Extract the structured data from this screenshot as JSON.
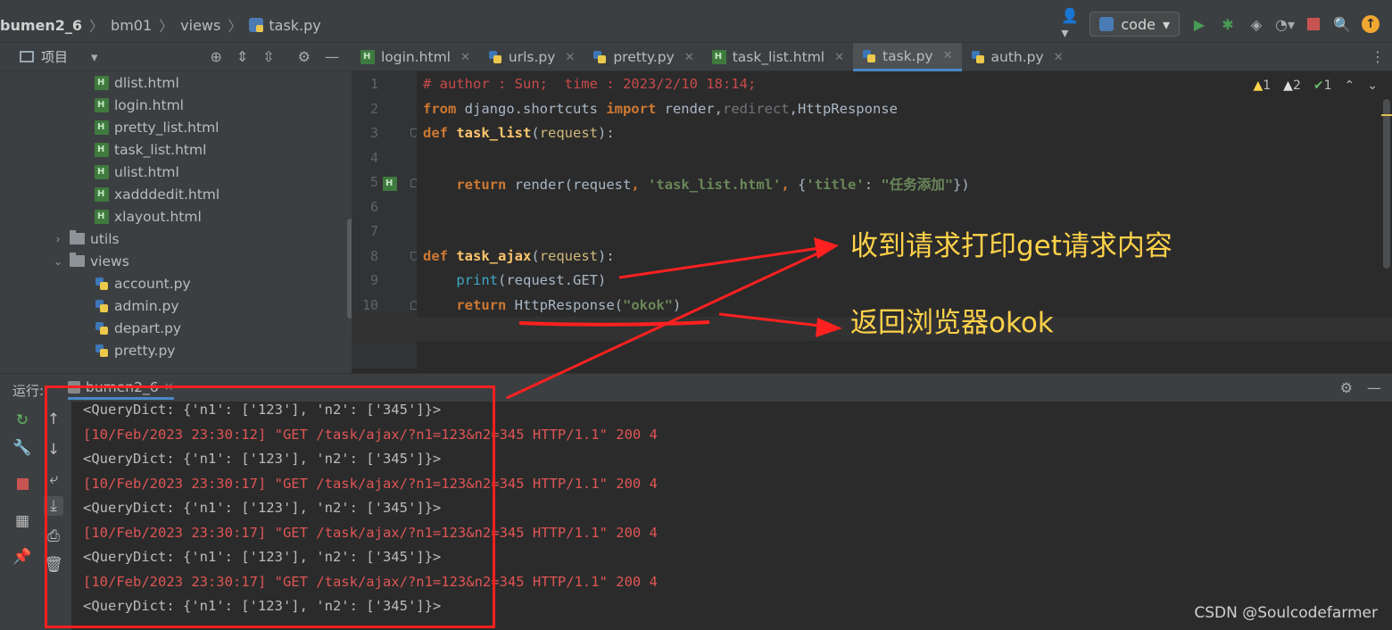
{
  "breadcrumb": {
    "project": "bumen2_6",
    "folder1": "bm01",
    "folder2": "views",
    "file": "task.py"
  },
  "toolbar": {
    "run_config": "code"
  },
  "project_panel": {
    "title": "项目"
  },
  "tree": {
    "files_html": [
      "dlist.html",
      "login.html",
      "pretty_list.html",
      "task_list.html",
      "ulist.html",
      "xadddedit.html",
      "xlayout.html"
    ],
    "folder_utils": "utils",
    "folder_views": "views",
    "files_py": [
      "account.py",
      "admin.py",
      "depart.py",
      "pretty.py"
    ]
  },
  "tabs": [
    {
      "label": "login.html",
      "type": "html",
      "active": false
    },
    {
      "label": "urls.py",
      "type": "py",
      "active": false
    },
    {
      "label": "pretty.py",
      "type": "py",
      "active": false
    },
    {
      "label": "task_list.html",
      "type": "html",
      "active": false
    },
    {
      "label": "task.py",
      "type": "py",
      "active": true
    },
    {
      "label": "auth.py",
      "type": "py",
      "active": false
    }
  ],
  "inspections": {
    "warn1": "1",
    "warn2": "2",
    "ok": "1"
  },
  "line_numbers": [
    "1",
    "2",
    "3",
    "4",
    "5",
    "6",
    "7",
    "8",
    "9",
    "10",
    "11"
  ],
  "code": {
    "l1": "# author : Sun;  time : 2023/2/10 18:14;",
    "l2_kw1": "from",
    "l2_mod": " django.shortcuts ",
    "l2_kw2": "import",
    "l2_a": " render",
    "l2_b": "redirect",
    "l2_c": "HttpResponse",
    "l3_kw": "def",
    "l3_fn": "task_list",
    "l3_param": "request",
    "l5_kw": "return",
    "l5_call": "render",
    "l5_arg": "request",
    "l5_s1": "'task_list.html'",
    "l5_key": "'title'",
    "l5_val": "\"任务添加\"",
    "l8_kw": "def",
    "l8_fn": "task_ajax",
    "l8_param": "request",
    "l9_print": "print",
    "l9_arg": "request.GET",
    "l10_kw": "return",
    "l10_call": "HttpResponse",
    "l10_s": "\"okok\""
  },
  "run_panel": {
    "label": "运行:",
    "tab": "bumen2_6"
  },
  "output": [
    {
      "type": "qd",
      "text": "<QueryDict: {'n1': ['123'], 'n2': ['345']}>"
    },
    {
      "type": "log",
      "text": "[10/Feb/2023 23:30:12] \"GET /task/ajax/?n1=123&n2=345 HTTP/1.1\" 200 4"
    },
    {
      "type": "qd",
      "text": "<QueryDict: {'n1': ['123'], 'n2': ['345']}>"
    },
    {
      "type": "log",
      "text": "[10/Feb/2023 23:30:17] \"GET /task/ajax/?n1=123&n2=345 HTTP/1.1\" 200 4"
    },
    {
      "type": "qd",
      "text": "<QueryDict: {'n1': ['123'], 'n2': ['345']}>"
    },
    {
      "type": "log",
      "text": "[10/Feb/2023 23:30:17] \"GET /task/ajax/?n1=123&n2=345 HTTP/1.1\" 200 4"
    },
    {
      "type": "qd",
      "text": "<QueryDict: {'n1': ['123'], 'n2': ['345']}>"
    },
    {
      "type": "log",
      "text": "[10/Feb/2023 23:30:17] \"GET /task/ajax/?n1=123&n2=345 HTTP/1.1\" 200 4"
    },
    {
      "type": "qd",
      "text": "<QueryDict: {'n1': ['123'], 'n2': ['345']}>"
    }
  ],
  "annotations": {
    "note1": "收到请求打印get请求内容",
    "note2": "返回浏览器okok",
    "color": "#ff2020"
  },
  "watermark": "CSDN @Soulcodefarmer"
}
